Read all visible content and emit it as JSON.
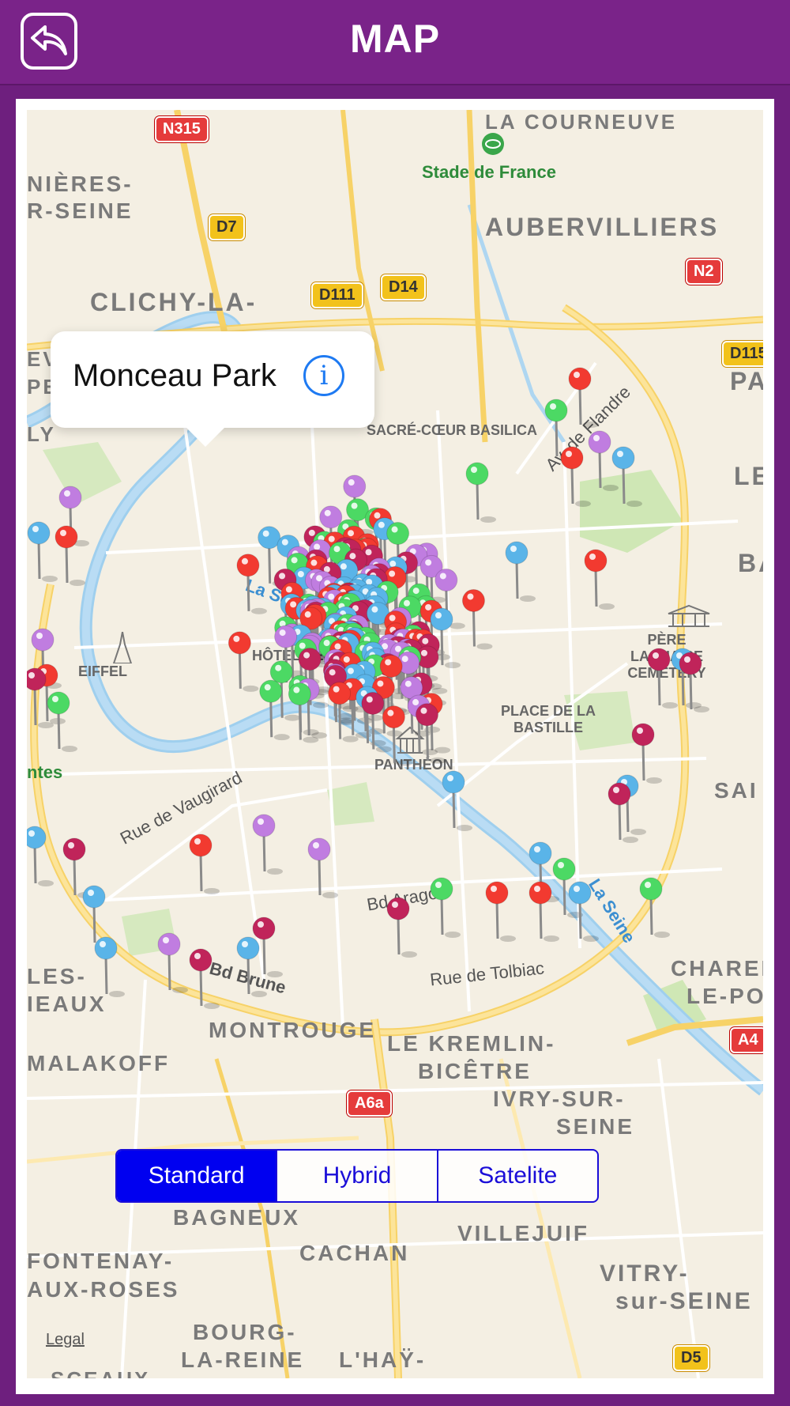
{
  "header": {
    "title": "MAP",
    "back_label": "Back"
  },
  "callout": {
    "title": "Monceau Park"
  },
  "map_type": {
    "options": [
      "Standard",
      "Hybrid",
      "Satelite"
    ],
    "selected": "Standard"
  },
  "legal_label": "Legal",
  "labels": {
    "stade": "Stade de France",
    "aubervilliers": "AUBERVILLIERS",
    "clichy": "CLICHY-LA-",
    "nieres": "NIÈRES-",
    "rseine": "R-SEINE",
    "courneuve": "LA COURNEUVE",
    "sacre": "SACRÉ-CŒUR BASILICA",
    "eiffel": "EIFFEL",
    "invalides": "HÔTEL DES INVALIDES",
    "pere": "PÈRE LACHAISE CEMETERY",
    "bastille": "PLACE DE LA BASTILLE",
    "pantheon": "PANTHÉON",
    "vaugirard": "Rue de Vaugirard",
    "arago": "Bd Arago",
    "tolbiac": "Rue de Tolbiac",
    "brune": "Bd Brune",
    "flandre": "Av. de Flandre",
    "laseine1": "La Seine",
    "laseine2": "La Seine",
    "montrouge": "MONTROUGE",
    "kremlin": "LE KREMLIN-",
    "bicetre": "BICÊTRE",
    "ivry": "IVRY-SUR-",
    "ivry2": "SEINE",
    "malakoff": "MALAKOFF",
    "bagneux": "BAGNEUX",
    "cachan": "CACHAN",
    "villejuif": "VILLEJUIF",
    "vitry": "VITRY-",
    "vitry2": "sur-SEINE",
    "fontenay": "FONTENAY-",
    "fontenay2": "AUX-ROSES",
    "bourg": "BOURG-",
    "bourg2": "LA-REINE",
    "lhay": "L'HAŸ-",
    "sceaux": "SCEAUX",
    "charenton": "CHAREN",
    "charenton2": "LE-PO",
    "les": "LES-",
    "ieaux": "IEAUX",
    "pa": "PA",
    "le": "LE",
    "ba": "BA",
    "sai": "SAI",
    "ntes": "ntes",
    "perret": "PERRET",
    "ev": "EV",
    "ly": "LY"
  },
  "shields": {
    "n315": "N315",
    "d7": "D7",
    "d111": "D111",
    "d14": "D14",
    "n2": "N2",
    "d115": "D115",
    "a6a": "A6a",
    "a4": "A4",
    "d5": "D5"
  },
  "colors": {
    "header": "#7a2389",
    "pin_red": "#f23a30",
    "pin_green": "#4cd964",
    "pin_purple": "#c07de0",
    "pin_blue": "#5ab4e8",
    "pin_crimson": "#c0245a",
    "segment_active": "#0000f0"
  }
}
